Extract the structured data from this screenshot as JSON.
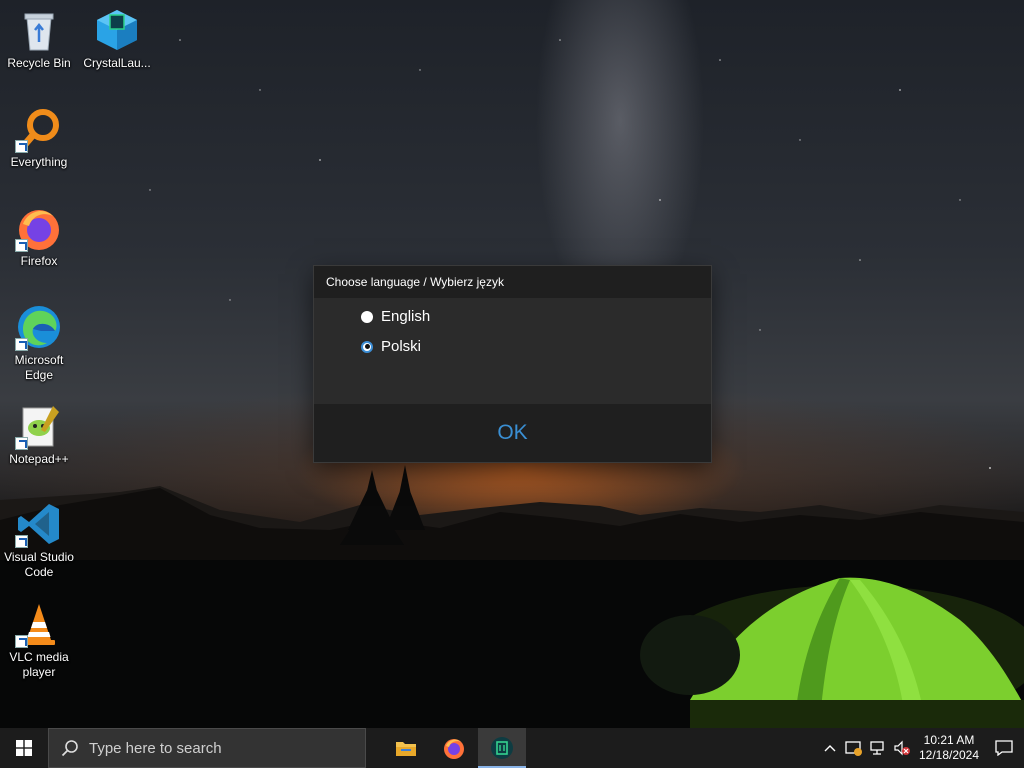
{
  "desktop": {
    "icons": [
      {
        "label": "Recycle Bin",
        "icon": "recycle-bin-icon"
      },
      {
        "label": "CrystalLau...",
        "icon": "crystal-launcher-icon"
      },
      {
        "label": "Everything",
        "icon": "everything-search-icon"
      },
      {
        "label": "Firefox",
        "icon": "firefox-icon"
      },
      {
        "label": "Microsoft Edge",
        "icon": "edge-icon"
      },
      {
        "label": "Notepad++",
        "icon": "notepadpp-icon"
      },
      {
        "label": "Visual Studio Code",
        "icon": "vscode-icon"
      },
      {
        "label": "VLC media player",
        "icon": "vlc-icon"
      }
    ]
  },
  "dialog": {
    "title": "Choose language / Wybierz język",
    "options": [
      {
        "label": "English",
        "checked": false
      },
      {
        "label": "Polski",
        "checked": true
      }
    ],
    "ok_label": "OK"
  },
  "taskbar": {
    "search_placeholder": "Type here to search",
    "apps": [
      {
        "name": "File Explorer",
        "icon": "folder-icon",
        "active": false
      },
      {
        "name": "Firefox",
        "icon": "firefox-icon",
        "active": false
      },
      {
        "name": "CrystalLauncher",
        "icon": "crystal-launcher-icon",
        "active": true
      }
    ],
    "clock_time": "10:21 AM",
    "clock_date": "12/18/2024"
  },
  "colors": {
    "accent": "#3a8fd3",
    "dialog_bg": "#2b2b2b",
    "dialog_header": "#1f1f1f",
    "taskbar_bg": "#1c1c1c"
  }
}
